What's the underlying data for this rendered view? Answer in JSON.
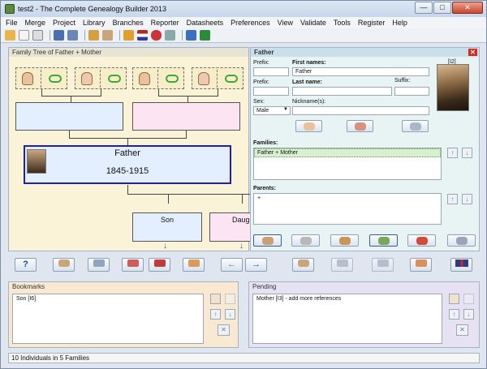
{
  "window": {
    "title": "test2 - The Complete Genealogy Builder 2013",
    "minimize": "—",
    "maximize": "□",
    "close": "✕"
  },
  "menu": [
    "File",
    "Merge",
    "Project",
    "Library",
    "Branches",
    "Reporter",
    "Datasheets",
    "Preferences",
    "View",
    "Validate",
    "Tools",
    "Register",
    "Help"
  ],
  "tree": {
    "header": "Family Tree of Father + Mother",
    "main_person": {
      "name": "Father",
      "dates": "1845-1915"
    },
    "children": [
      {
        "label": "Son"
      },
      {
        "label": "Daugh"
      }
    ]
  },
  "person_panel": {
    "header": "Father",
    "id_badge": "[I2]",
    "prefix_label": "Prefix:",
    "first_names_label": "First names:",
    "first_names_value": "Father",
    "last_prefix_label": "Prefix:",
    "last_name_label": "Last name:",
    "suffix_label": "Suffix:",
    "sex_label": "Sex:",
    "sex_value": "Male",
    "nickname_label": "Nickname(s):",
    "families_label": "Families:",
    "families": [
      "Father + Mother"
    ],
    "parents_label": "Parents:",
    "parents": [
      "+"
    ]
  },
  "bookmarks": {
    "header": "Bookmarks",
    "items": [
      "Son   [I6]"
    ]
  },
  "pending": {
    "header": "Pending",
    "items": [
      "Mother   [I3] - add more references"
    ]
  },
  "status": "10 Individuals in 5 Families",
  "bottom_buttons": {
    "help": "?",
    "back": "←",
    "forward": "→"
  },
  "colors": {
    "tree_bg": "#faf3d7",
    "male_box": "#e3efff",
    "female_box": "#fde4f3",
    "bookmarks_bg": "#fae9d2",
    "pending_bg": "#e6e1f3",
    "selection_border": "#2020b0"
  }
}
